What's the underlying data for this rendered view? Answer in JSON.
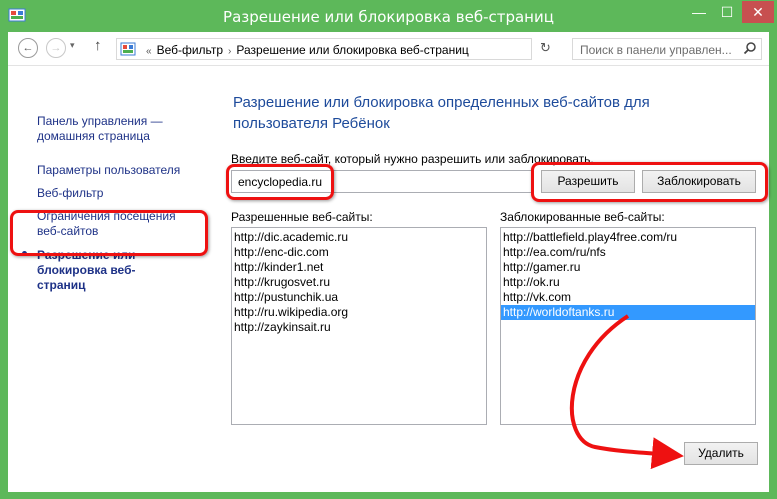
{
  "window": {
    "title": "Разрешение или блокировка веб-страниц",
    "minimize": "—",
    "maximize": "☐",
    "close": "✕",
    "accent_color": "#5db85a",
    "close_color": "#c75050"
  },
  "navigation": {
    "back_icon": "arrow-left-icon",
    "forward_icon": "arrow-right-icon",
    "back": "←",
    "forward": "→",
    "recent": "▾",
    "up": "↑",
    "breadcrumb": {
      "prefix": "«",
      "items": [
        "Веб-фильтр",
        "Разрешение или блокировка веб-страниц"
      ],
      "separator": "›"
    },
    "dropdown": "▾",
    "refresh": "↻",
    "search_placeholder": "Поиск в панели управлен..."
  },
  "sidebar": {
    "items": [
      {
        "label": "Панель управления — домашняя страница"
      },
      {
        "label": "Параметры пользователя"
      },
      {
        "label": "Веб-фильтр"
      },
      {
        "label": "Ограничения посещения веб-сайтов"
      },
      {
        "label": "Разрешение или блокировка веб-страниц",
        "active": true
      }
    ]
  },
  "main": {
    "heading": "Разрешение или блокировка определенных веб-сайтов для пользователя Ребёнок",
    "input_label": "Введите веб-сайт, который нужно разрешить или заблокировать.",
    "input_value": "encyclopedia.ru",
    "allow_button": "Разрешить",
    "block_button": "Заблокировать",
    "allowed_label": "Разрешенные веб-сайты:",
    "blocked_label": "Заблокированные веб-сайты:",
    "allowed_sites": [
      "http://dic.academic.ru",
      "http://enc-dic.com",
      "http://kinder1.net",
      "http://krugosvet.ru",
      "http://pustunchik.ua",
      "http://ru.wikipedia.org",
      "http://zaykinsait.ru"
    ],
    "blocked_sites": [
      "http://battlefield.play4free.com/ru",
      "http://ea.com/ru/nfs",
      "http://gamer.ru",
      "http://ok.ru",
      "http://vk.com",
      "http://worldoftanks.ru"
    ],
    "blocked_selected_index": 5,
    "delete_button": "Удалить"
  },
  "annotation_color": "#e11111"
}
